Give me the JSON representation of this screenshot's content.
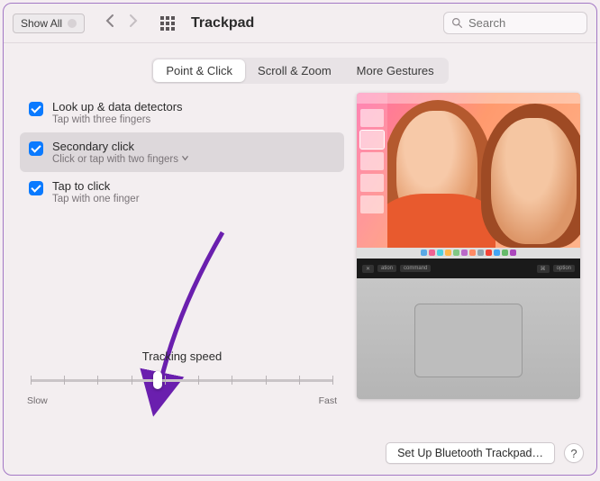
{
  "toolbar": {
    "show_all_label": "Show All",
    "title": "Trackpad",
    "search_placeholder": "Search"
  },
  "tabs": [
    {
      "label": "Point & Click",
      "active": true
    },
    {
      "label": "Scroll & Zoom",
      "active": false
    },
    {
      "label": "More Gestures",
      "active": false
    }
  ],
  "options": [
    {
      "label": "Look up & data detectors",
      "sub": "Tap with three fingers",
      "checked": true,
      "selected": false,
      "dropdown": false
    },
    {
      "label": "Secondary click",
      "sub": "Click or tap with two fingers",
      "checked": true,
      "selected": true,
      "dropdown": true
    },
    {
      "label": "Tap to click",
      "sub": "Tap with one finger",
      "checked": true,
      "selected": false,
      "dropdown": false
    }
  ],
  "tracking": {
    "header": "Tracking speed",
    "min_label": "Slow",
    "max_label": "Fast",
    "tick_count": 10,
    "value_index": 4
  },
  "footer": {
    "setup_button": "Set Up Bluetooth Trackpad…",
    "help_label": "?"
  },
  "annotation": {
    "arrow_color": "#6a1fae"
  }
}
